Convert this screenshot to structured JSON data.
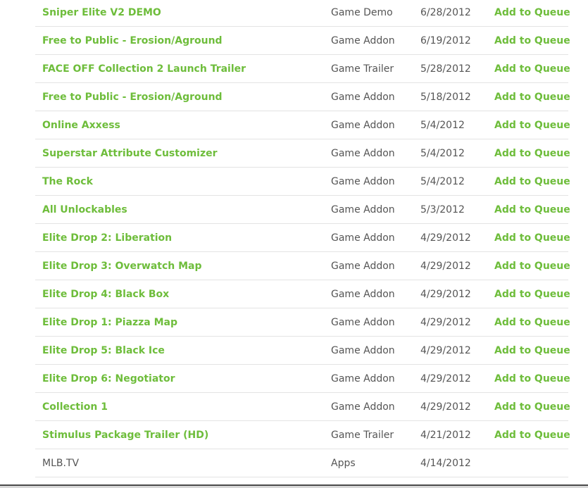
{
  "rows": [
    {
      "title": "Sniper Elite V2 DEMO",
      "type": "Game Demo",
      "date": "6/28/2012",
      "action": "Add to Queue"
    },
    {
      "title": "Free to Public - Erosion/Aground",
      "type": "Game Addon",
      "date": "6/19/2012",
      "action": "Add to Queue"
    },
    {
      "title": "FACE OFF Collection 2 Launch Trailer",
      "type": "Game Trailer",
      "date": "5/28/2012",
      "action": "Add to Queue"
    },
    {
      "title": "Free to Public - Erosion/Aground",
      "type": "Game Addon",
      "date": "5/18/2012",
      "action": "Add to Queue"
    },
    {
      "title": "Online Axxess",
      "type": "Game Addon",
      "date": "5/4/2012",
      "action": "Add to Queue"
    },
    {
      "title": "Superstar Attribute Customizer",
      "type": "Game Addon",
      "date": "5/4/2012",
      "action": "Add to Queue"
    },
    {
      "title": "The Rock",
      "type": "Game Addon",
      "date": "5/4/2012",
      "action": "Add to Queue"
    },
    {
      "title": "All Unlockables",
      "type": "Game Addon",
      "date": "5/3/2012",
      "action": "Add to Queue"
    },
    {
      "title": "Elite Drop 2: Liberation",
      "type": "Game Addon",
      "date": "4/29/2012",
      "action": "Add to Queue"
    },
    {
      "title": "Elite Drop 3: Overwatch Map",
      "type": "Game Addon",
      "date": "4/29/2012",
      "action": "Add to Queue"
    },
    {
      "title": "Elite Drop 4: Black Box",
      "type": "Game Addon",
      "date": "4/29/2012",
      "action": "Add to Queue"
    },
    {
      "title": "Elite Drop 1: Piazza Map",
      "type": "Game Addon",
      "date": "4/29/2012",
      "action": "Add to Queue"
    },
    {
      "title": "Elite Drop 5: Black Ice",
      "type": "Game Addon",
      "date": "4/29/2012",
      "action": "Add to Queue"
    },
    {
      "title": "Elite Drop 6: Negotiator",
      "type": "Game Addon",
      "date": "4/29/2012",
      "action": "Add to Queue"
    },
    {
      "title": "Collection 1",
      "type": "Game Addon",
      "date": "4/29/2012",
      "action": "Add to Queue"
    },
    {
      "title": "Stimulus Package Trailer (HD)",
      "type": "Game Trailer",
      "date": "4/21/2012",
      "action": "Add to Queue"
    },
    {
      "title": "MLB.TV",
      "type": "Apps",
      "date": "4/14/2012",
      "action": ""
    }
  ],
  "colors": {
    "link_green": "#6ebd3b",
    "text_gray": "#555555",
    "divider": "#e3e3e3"
  }
}
